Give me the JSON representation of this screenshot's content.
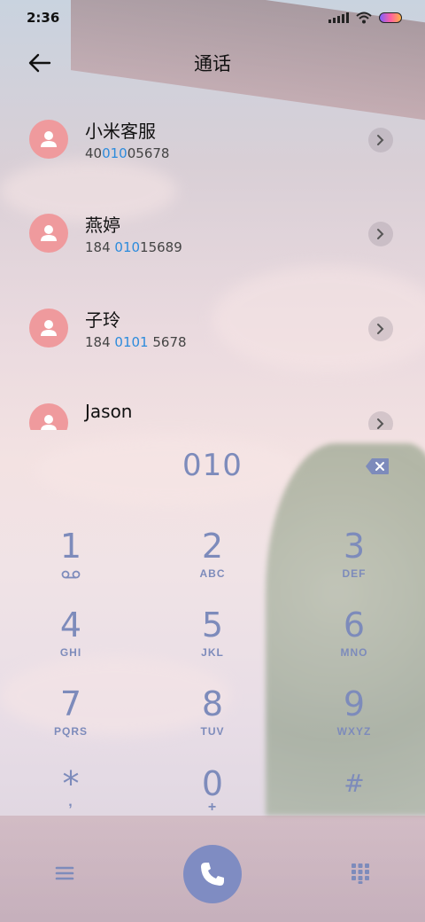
{
  "status_bar": {
    "time": "2:36"
  },
  "header": {
    "title": "通话"
  },
  "contacts": [
    {
      "name": "小米客服",
      "number_before": "40",
      "number_match": "010",
      "number_after": "05678"
    },
    {
      "name": "燕婷",
      "number_before": "184 ",
      "number_match": "010",
      "number_after": "15689"
    },
    {
      "name": "子玲",
      "number_before": "184 ",
      "number_match": "0101",
      "number_after": " 5678"
    },
    {
      "name": "Jason",
      "number_before": "",
      "number_match": "",
      "number_after": ""
    }
  ],
  "dialer": {
    "entered_number": "010",
    "keys": [
      {
        "digit": "1",
        "letters": "voicemail-icon"
      },
      {
        "digit": "2",
        "letters": "ABC"
      },
      {
        "digit": "3",
        "letters": "DEF"
      },
      {
        "digit": "4",
        "letters": "GHI"
      },
      {
        "digit": "5",
        "letters": "JKL"
      },
      {
        "digit": "6",
        "letters": "MNO"
      },
      {
        "digit": "7",
        "letters": "PQRS"
      },
      {
        "digit": "8",
        "letters": "TUV"
      },
      {
        "digit": "9",
        "letters": "WXYZ"
      },
      {
        "digit": "*",
        "letters": ","
      },
      {
        "digit": "0",
        "letters": "+"
      },
      {
        "digit": "#",
        "letters": ""
      }
    ]
  },
  "colors": {
    "accent": "#7d8bbb",
    "match": "#2c8bdc",
    "avatar": "#ef9a9d",
    "call_button": "#7f8cc2"
  }
}
